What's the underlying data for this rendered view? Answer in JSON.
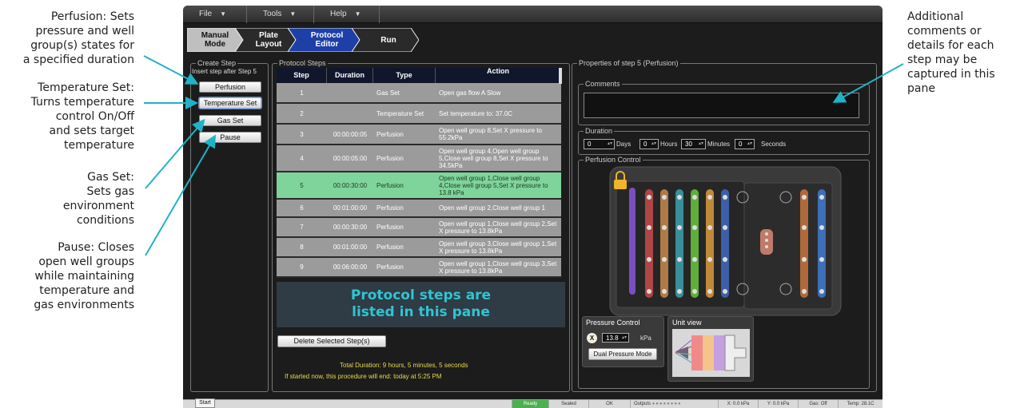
{
  "annotations": {
    "perfusion": [
      "Perfusion: Sets",
      "pressure and well",
      "group(s) states for",
      "a specified duration"
    ],
    "temperature": [
      "Temperature Set:",
      "Turns temperature",
      "control On/Off",
      "and sets target",
      "temperature"
    ],
    "gas": [
      "Gas Set:",
      "Sets gas",
      "environment",
      "conditions"
    ],
    "pause": [
      "Pause: Closes",
      "open well groups",
      "while maintaining",
      "temperature and",
      "gas environments"
    ],
    "comments": [
      "Additional",
      "comments or",
      "details for each",
      "step may be",
      "captured in this",
      "pane"
    ],
    "arrow_color": "#1fb3c8"
  },
  "menu": {
    "file": "File",
    "tools": "Tools",
    "help": "Help"
  },
  "wizard": {
    "steps": [
      {
        "line1": "Manual",
        "line2": "Mode"
      },
      {
        "line1": "Plate",
        "line2": "Layout"
      },
      {
        "line1": "Protocol",
        "line2": "Editor"
      },
      {
        "line1": "Run",
        "line2": ""
      }
    ],
    "active_step": "Protocol Editor",
    "active_color": "#1e3fa8"
  },
  "create_step": {
    "title": "Create Step",
    "subtitle": "Insert step after Step 5",
    "buttons": [
      "Perfusion",
      "Temperature Set",
      "Gas Set",
      "Pause"
    ]
  },
  "protocol_steps": {
    "title": "Protocol Steps",
    "columns": [
      "Step",
      "Duration",
      "Type",
      "Action"
    ],
    "rows": [
      {
        "step": "1",
        "duration": "",
        "type": "Gas Set",
        "action": "Open gas flow A Slow"
      },
      {
        "step": "2",
        "duration": "",
        "type": "Temperature Set",
        "action": "Set temperature to: 37.0C"
      },
      {
        "step": "3",
        "duration": "00:00:00:05",
        "type": "Perfusion",
        "action": "Open well group 8,Set X pressure to 55.2kPa"
      },
      {
        "step": "4",
        "duration": "00:00:05:00",
        "type": "Perfusion",
        "action": "Open well group 4,Open well group 5,Close well group 8,Set X pressure to 34.5kPa"
      },
      {
        "step": "5",
        "duration": "00:00:30:00",
        "type": "Perfusion",
        "action": "Open well group 1,Close well group 4,Close well group 5,Set X pressure to 13.8 kPa"
      },
      {
        "step": "6",
        "duration": "00:01:00:00",
        "type": "Perfusion",
        "action": "Open well group 2,Close well group 1"
      },
      {
        "step": "7",
        "duration": "00:00:30:00",
        "type": "Perfusion",
        "action": "Open well group 1,Close well group 2,Set X pressure to 13.8kPa"
      },
      {
        "step": "8",
        "duration": "00:01:00:00",
        "type": "Perfusion",
        "action": "Open well group 3,Close well group 1,Set X pressure to 13.8kPa"
      },
      {
        "step": "9",
        "duration": "00:06:00:00",
        "type": "Perfusion",
        "action": "Open well group 1,Close well group 3,Set X pressure to 13.8kPa"
      }
    ],
    "selected_step": "5",
    "overlay_line1": "Protocol steps are",
    "overlay_line2": "listed in this pane",
    "delete_button": "Delete Selected Step(s)",
    "total_duration": "Total Duration: 9 hours, 5 minutes, 5 seconds",
    "end_time": "If started now, this procedure will end: today at 5:25 PM"
  },
  "properties": {
    "title": "Properties of step 5 (Perfusion)",
    "comments_label": "Comments",
    "comments_value": "",
    "duration_label": "Duration",
    "days": "0",
    "days_label": "Days",
    "hours": "0",
    "hours_label": "Hours",
    "minutes": "30",
    "minutes_label": "Minutes",
    "seconds": "0",
    "seconds_label": "Seconds",
    "perfusion_label": "Perfusion Control",
    "pressure_label": "Pressure Control",
    "pressure_channel": "X",
    "pressure_value": "13.8",
    "pressure_unit": "kPa",
    "dual_mode_button": "Dual Pressure Mode",
    "unit_view_label": "Unit view"
  },
  "status_bar": {
    "start": "Start",
    "ready": "Ready",
    "sealed": "Sealed",
    "ok": "OK",
    "outputs": "Outputs",
    "x": "X: 0.0 kPa",
    "y": "Y: 0.0 kPa",
    "gas": "Gas: Off",
    "temp": "Temp: 28.1C"
  }
}
